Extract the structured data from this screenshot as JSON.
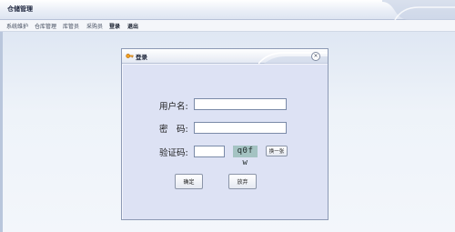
{
  "app": {
    "title": "仓储管理"
  },
  "menu": {
    "items": [
      {
        "label": "系统维护",
        "bold": false
      },
      {
        "label": "仓库管理",
        "bold": false
      },
      {
        "label": "库管员",
        "bold": false
      },
      {
        "label": "采购员",
        "bold": false
      },
      {
        "label": "登录",
        "bold": true
      },
      {
        "label": "退出",
        "bold": true
      }
    ]
  },
  "dialog": {
    "title": "登录",
    "close_symbol": "×",
    "username_label": "用户名:",
    "username_value": "",
    "password_label": "密　码:",
    "password_value": "",
    "captcha_label": "验证码:",
    "captcha_input_value": "",
    "captcha_text": "q0f w",
    "refresh_label": "换一张",
    "confirm_label": "确定",
    "cancel_label": "放弃"
  },
  "colors": {
    "dialog_body": "#dde2f4",
    "captcha_bg": "#a4c3c2"
  },
  "icons": {
    "dialog_icon": "key-icon",
    "close": "close-icon"
  }
}
